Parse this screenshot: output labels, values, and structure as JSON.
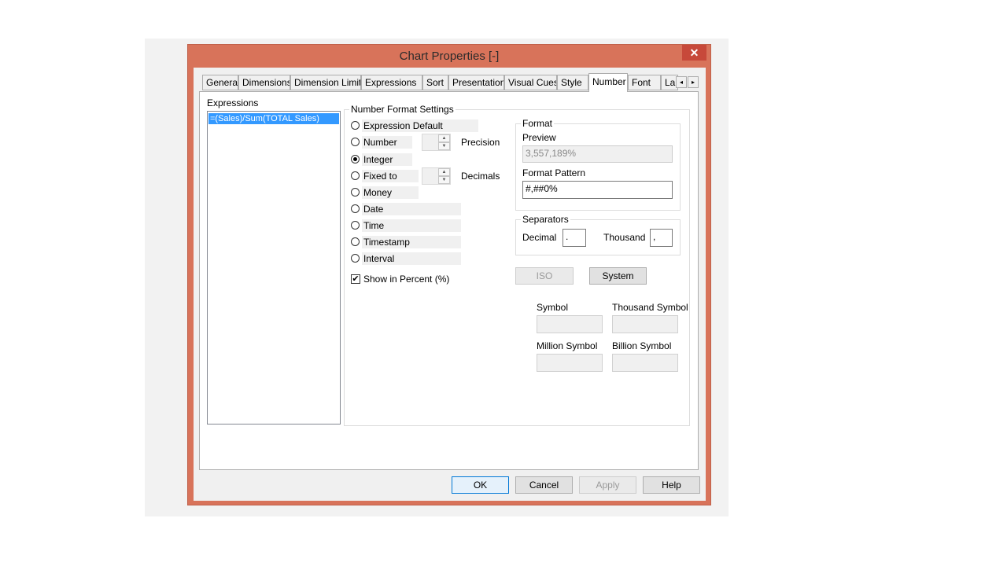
{
  "window": {
    "title": "Chart Properties [-]",
    "close_glyph": "✕"
  },
  "tabs": [
    "General",
    "Dimensions",
    "Dimension Limits",
    "Expressions",
    "Sort",
    "Presentation",
    "Visual Cues",
    "Style",
    "Number",
    "Font",
    "La"
  ],
  "active_tab": "Number",
  "tab_scroll": {
    "left_glyph": "◂",
    "right_glyph": "▸"
  },
  "expressions": {
    "label": "Expressions",
    "items": [
      "=(Sales)/Sum(TOTAL Sales)"
    ]
  },
  "number_format": {
    "label": "Number Format Settings",
    "options": [
      "Expression Default",
      "Number",
      "Integer",
      "Fixed to",
      "Money",
      "Date",
      "Time",
      "Timestamp",
      "Interval"
    ],
    "selected": "Integer",
    "precision_label": "Precision",
    "decimals_label": "Decimals",
    "show_in_percent_label": "Show in Percent (%)",
    "show_in_percent_checked": true,
    "check_glyph": "✔"
  },
  "format": {
    "label": "Format",
    "preview_label": "Preview",
    "preview_value": "3,557,189%",
    "pattern_label": "Format Pattern",
    "pattern_value": "#,##0%"
  },
  "separators": {
    "label": "Separators",
    "decimal_label": "Decimal",
    "decimal_value": ".",
    "thousand_label": "Thousand",
    "thousand_value": ","
  },
  "buttons": {
    "iso": "ISO",
    "system": "System",
    "ok": "OK",
    "cancel": "Cancel",
    "apply": "Apply",
    "help": "Help"
  },
  "symbols": {
    "symbol_label": "Symbol",
    "thousand_label": "Thousand Symbol",
    "million_label": "Million Symbol",
    "billion_label": "Billion Symbol"
  },
  "colors": {
    "window_frame": "#d8735a",
    "close_button": "#c7493a",
    "selection": "#3399ff"
  }
}
